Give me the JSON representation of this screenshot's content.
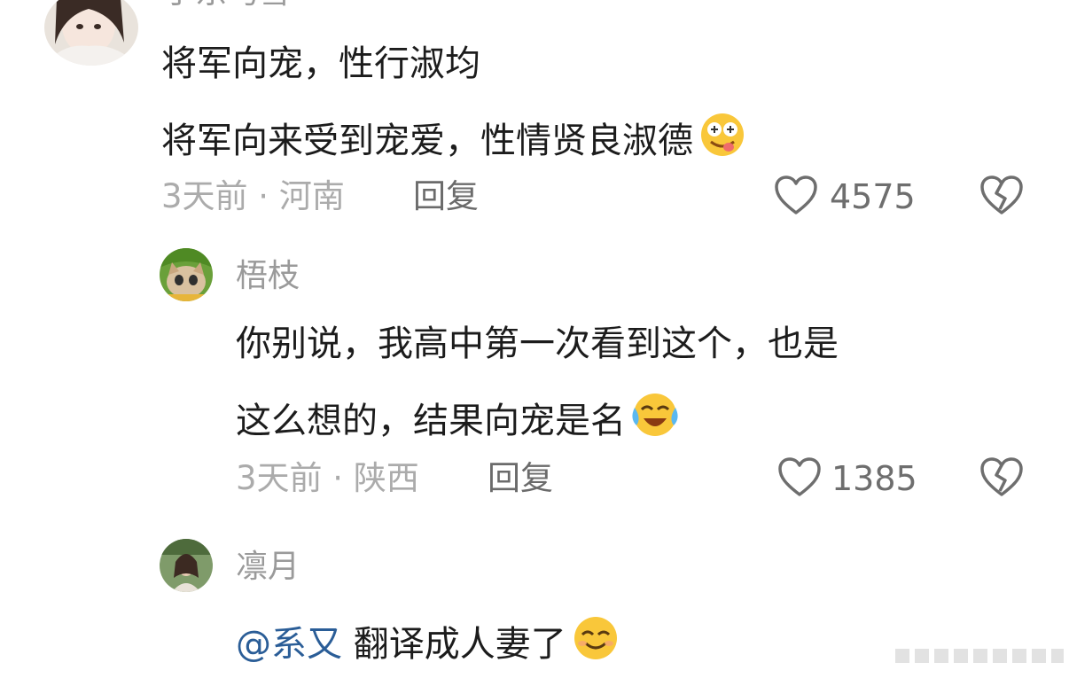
{
  "comments": [
    {
      "username": "于东马雪",
      "lines": [
        "将军向宠，性行淑均",
        "将军向来受到宠爱，性情贤良淑德"
      ],
      "emoji": "drooling-face-emoji",
      "time": "3天前",
      "location": "河南",
      "reply_label": "回复",
      "likes": "4575"
    },
    {
      "username": "梧枝",
      "lines": [
        "你别说，我高中第一次看到这个，也是",
        "这么想的，结果向宠是名"
      ],
      "emoji": "crying-laughing-face-emoji",
      "time": "3天前",
      "location": "陕西",
      "reply_label": "回复",
      "likes": "1385"
    },
    {
      "username": "凛月",
      "mention": "@系又",
      "text": "翻译成人妻了",
      "emoji": "smiling-face-emoji"
    }
  ],
  "colors": {
    "mention": "#2a5d97",
    "meta": "#ababab",
    "username": "#9a9a9a"
  }
}
